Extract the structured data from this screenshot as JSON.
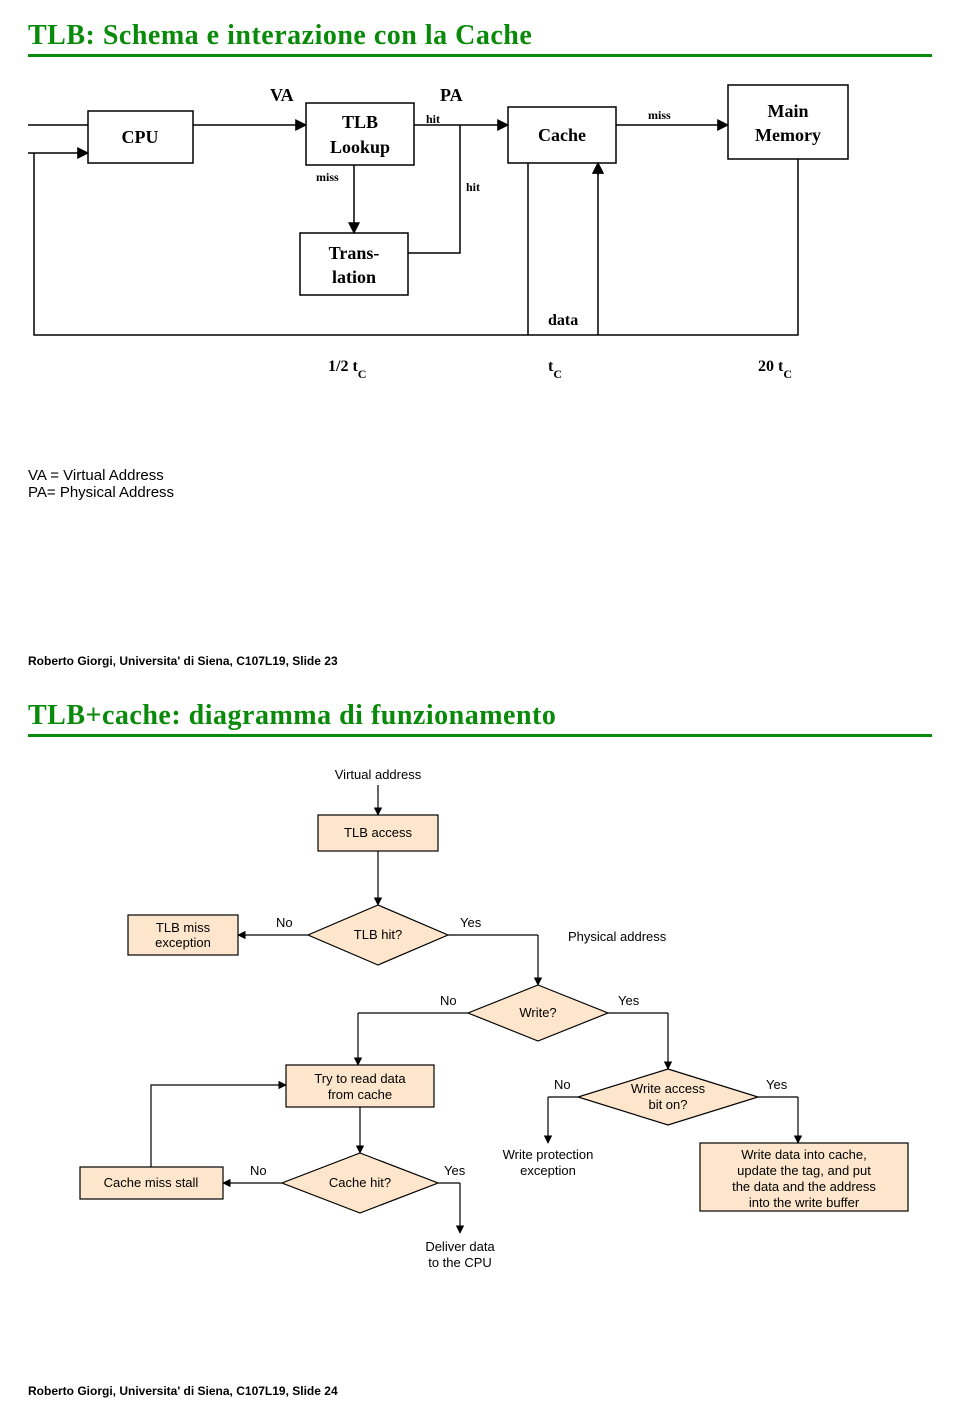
{
  "slide1": {
    "title": "TLB: Schema e interazione con la Cache",
    "footer": "Roberto Giorgi, Universita' di Siena, C107L19,  Slide 23",
    "boxes": {
      "cpu": "CPU",
      "tlb": "TLB\nLookup",
      "trans": "Trans-\nlation",
      "cache": "Cache",
      "main": "Main\nMemory"
    },
    "labels": {
      "va": "VA",
      "pa": "PA",
      "hit1": "hit",
      "miss1": "miss",
      "miss2": "miss",
      "hit2": "hit",
      "data": "data",
      "t1": "1/2 t",
      "tsub": "C",
      "t2": "t",
      "t3": "20 t"
    },
    "legend": {
      "va": "VA = Virtual Address",
      "pa": "PA= Physical Address"
    }
  },
  "slide2": {
    "title": "TLB+cache: diagramma di funzionamento",
    "footer": "Roberto Giorgi, Universita' di Siena, C107L19,  Slide 24",
    "nodes": {
      "va": "Virtual address",
      "tlb_access": "TLB access",
      "tlb_miss": "TLB miss\nexception",
      "tlb_hit": "TLB hit?",
      "pa": "Physical address",
      "write": "Write?",
      "read": "Try to read data\nfrom cache",
      "waccess": "Write access\nbit on?",
      "wprot": "Write protection\nexception",
      "wdata": "Write data into cache,\nupdate the tag, and put\nthe data and the address\ninto the write buffer",
      "cache_stall": "Cache miss stall",
      "cache_hit": "Cache hit?",
      "deliver": "Deliver data\nto the CPU"
    },
    "edges": {
      "no": "No",
      "yes": "Yes"
    }
  }
}
